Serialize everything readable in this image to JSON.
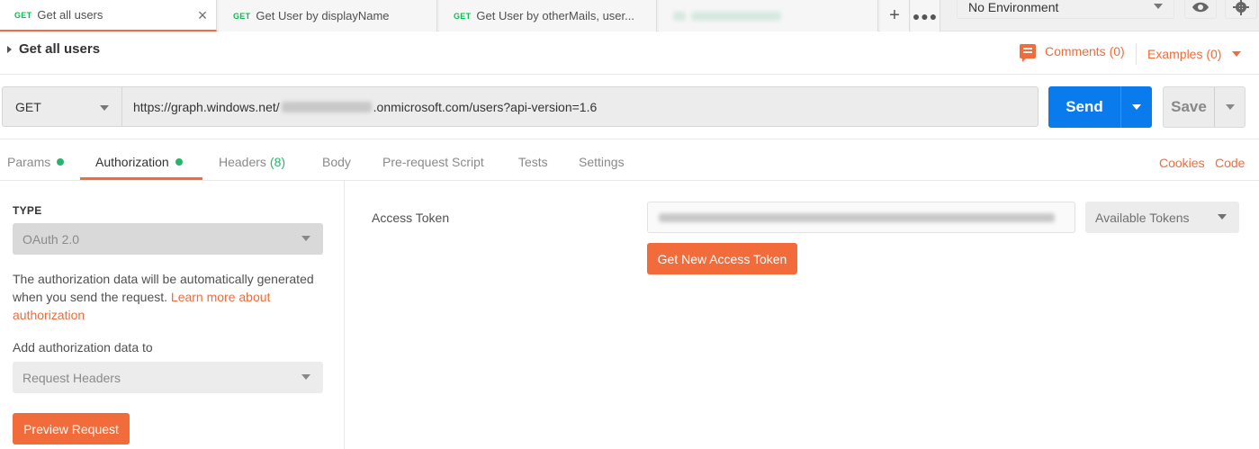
{
  "tabs": [
    {
      "method": "GET",
      "name": "Get all users",
      "active": true
    },
    {
      "method": "GET",
      "name": "Get User by displayName"
    },
    {
      "method": "GET",
      "name": "Get User by otherMails, user..."
    }
  ],
  "tab_icons": {
    "close": "close-icon",
    "add": "plus-icon",
    "more": "ellipsis-icon"
  },
  "environment": {
    "selected": "No Environment"
  },
  "header_icons": {
    "eye": "eye-icon",
    "settings": "gear-icon"
  },
  "request": {
    "title": "Get all users",
    "comments_label": "Comments (0)",
    "examples_label": "Examples (0)"
  },
  "url_bar": {
    "method": "GET",
    "url_prefix": "https://graph.windows.net/",
    "url_suffix": ".onmicrosoft.com/users?api-version=1.6",
    "send_label": "Send",
    "save_label": "Save"
  },
  "subtabs": {
    "params": "Params",
    "authorization": "Authorization",
    "headers": "Headers",
    "headers_count": "(8)",
    "body": "Body",
    "prerequest": "Pre-request Script",
    "tests": "Tests",
    "settings": "Settings",
    "cookies": "Cookies",
    "code": "Code"
  },
  "auth": {
    "type_label": "TYPE",
    "type_value": "OAuth 2.0",
    "help_text": "The authorization data will be automatically generated when you send the request.",
    "learn_more": "Learn more about authorization",
    "add_to_label": "Add authorization data to",
    "add_to_value": "Request Headers",
    "preview_button": "Preview Request",
    "access_token_label": "Access Token",
    "available_tokens": "Available Tokens",
    "get_new_token": "Get New Access Token"
  },
  "colors": {
    "accent": "#f26b3a",
    "send": "#097bed",
    "method_get": "#0cbb52",
    "dot": "#28b46e"
  }
}
